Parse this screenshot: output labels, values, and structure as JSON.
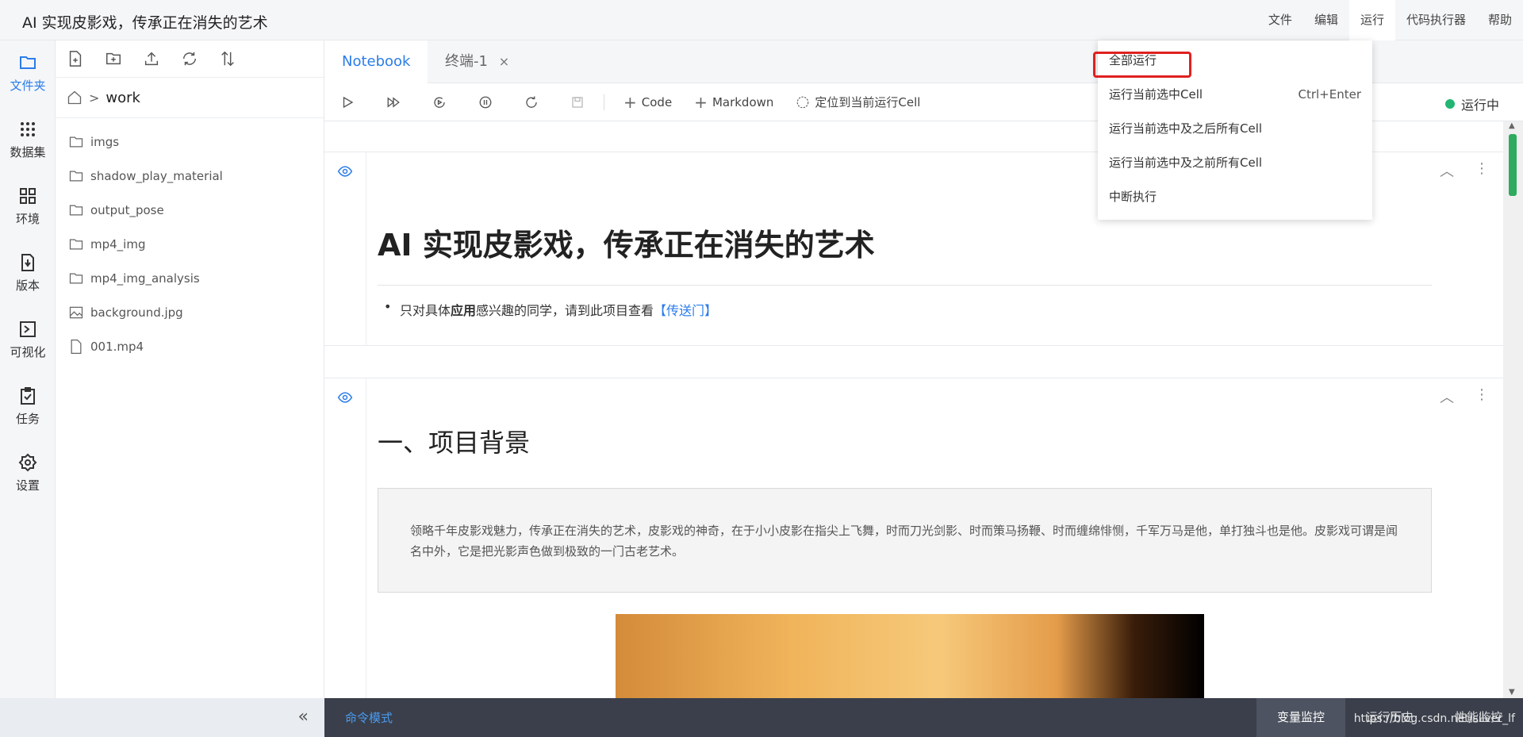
{
  "app": {
    "title": "AI 实现皮影戏，传承正在消失的艺术"
  },
  "menubar": {
    "items": [
      "文件",
      "编辑",
      "运行",
      "代码执行器",
      "帮助"
    ],
    "active": "运行"
  },
  "iconbar": {
    "items": [
      {
        "label": "文件夹",
        "icon": "folder-icon"
      },
      {
        "label": "数据集",
        "icon": "dataset-icon"
      },
      {
        "label": "环境",
        "icon": "environment-icon"
      },
      {
        "label": "版本",
        "icon": "version-icon"
      },
      {
        "label": "可视化",
        "icon": "visualize-icon"
      },
      {
        "label": "任务",
        "icon": "task-icon"
      },
      {
        "label": "设置",
        "icon": "settings-icon"
      }
    ]
  },
  "filepanel": {
    "breadcrumb": {
      "separator": ">",
      "current": "work"
    },
    "files": [
      {
        "name": "imgs",
        "type": "folder"
      },
      {
        "name": "shadow_play_material",
        "type": "folder"
      },
      {
        "name": "output_pose",
        "type": "folder"
      },
      {
        "name": "mp4_img",
        "type": "folder"
      },
      {
        "name": "mp4_img_analysis",
        "type": "folder"
      },
      {
        "name": "background.jpg",
        "type": "image"
      },
      {
        "name": "001.mp4",
        "type": "file"
      }
    ],
    "collapse_label": "«"
  },
  "tabs": {
    "notebook": "Notebook",
    "terminal": "终端-1",
    "close": "×"
  },
  "toolbar": {
    "code_label": "Code",
    "markdown_label": "Markdown",
    "locate_label": "定位到当前运行Cell",
    "status_label": "运行中",
    "plus": "+"
  },
  "dropdown": {
    "items": [
      {
        "label": "全部运行",
        "shortcut": ""
      },
      {
        "label": "运行当前选中Cell",
        "shortcut": "Ctrl+Enter"
      },
      {
        "label": "运行当前选中及之后所有Cell",
        "shortcut": ""
      },
      {
        "label": "运行当前选中及之前所有Cell",
        "shortcut": ""
      },
      {
        "label": "中断执行",
        "shortcut": ""
      }
    ]
  },
  "cells": {
    "cell1": {
      "heading": "AI 实现皮影戏，传承正在消失的艺术",
      "bullet_prefix": "只对具体",
      "bullet_strong": "应用",
      "bullet_middle": "感兴趣的同学，请到此项目查看",
      "bullet_link": "【传送门】"
    },
    "cell2": {
      "heading": "一、项目背景",
      "quote": "领略千年皮影戏魅力，传承正在消失的艺术，皮影戏的神奇，在于小小皮影在指尖上飞舞，时而刀光剑影、时而策马扬鞭、时而缠绵悱恻，千军万马是他，单打独斗也是他。皮影戏可谓是闻名中外，它是把光影声色做到极致的一门古老艺术。"
    },
    "tool_up": "︿",
    "tool_more": "⋮"
  },
  "bottom": {
    "mode": "命令模式",
    "tabs": [
      "变量监控",
      "运行历史",
      "性能监控"
    ],
    "active": "变量监控",
    "watermark": "https://blog.csdn.net/silver_lf"
  },
  "colors": {
    "accent": "#2b7ce9",
    "running": "#22b573",
    "highlight": "#e02020"
  }
}
